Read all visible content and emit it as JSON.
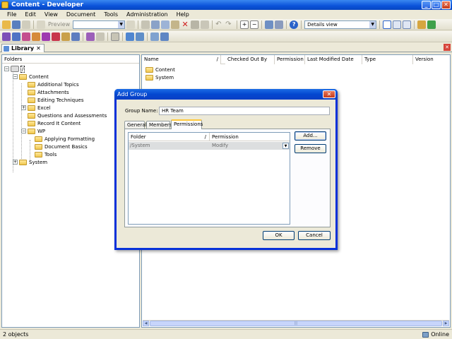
{
  "window": {
    "title": "Content - Developer"
  },
  "menu": [
    "File",
    "Edit",
    "View",
    "Document",
    "Tools",
    "Administration",
    "Help"
  ],
  "toolbar": {
    "preview_label": "Preview",
    "view_select": "Details view"
  },
  "library_tab": {
    "label": "Library",
    "close": "✕"
  },
  "folders_panel": {
    "header": "Folders",
    "root": "/",
    "tree": [
      {
        "label": "Content",
        "level": 1,
        "expander": "−"
      },
      {
        "label": "Additional Topics",
        "level": 2
      },
      {
        "label": "Attachments",
        "level": 2
      },
      {
        "label": "Editing Techniques",
        "level": 2
      },
      {
        "label": "Excel",
        "level": 2,
        "expander": "+"
      },
      {
        "label": "Questions and Assessments",
        "level": 2
      },
      {
        "label": "Record It Content",
        "level": 2
      },
      {
        "label": "WP",
        "level": 2,
        "expander": "−"
      },
      {
        "label": "Applying Formatting",
        "level": 3
      },
      {
        "label": "Document Basics",
        "level": 3
      },
      {
        "label": "Tools",
        "level": 3
      },
      {
        "label": "System",
        "level": 1,
        "expander": "+"
      }
    ]
  },
  "list_panel": {
    "columns": [
      "Name",
      "/",
      "Checked Out By",
      "Permission",
      "Last Modified Date",
      "Type",
      "Version"
    ],
    "rows": [
      "Content",
      "System"
    ]
  },
  "status": {
    "count": "2 objects",
    "connection": "Online"
  },
  "dialog": {
    "title": "Add Group",
    "close": "✕",
    "group_name_label": "Group Name:",
    "group_name_value": "HR Team",
    "tabs": [
      "General",
      "Members",
      "Permissions"
    ],
    "active_tab": "Permissions",
    "permissions": {
      "columns": [
        "Folder",
        "/",
        "Permission"
      ],
      "rows": [
        {
          "folder": "/System",
          "permission": "Modify"
        }
      ]
    },
    "buttons": {
      "add": "Add...",
      "remove": "Remove",
      "ok": "OK",
      "cancel": "Cancel"
    }
  },
  "colors": {
    "titlebar": "#0a52d9",
    "selection": "#dcdedf",
    "folder": "#f0c850"
  }
}
